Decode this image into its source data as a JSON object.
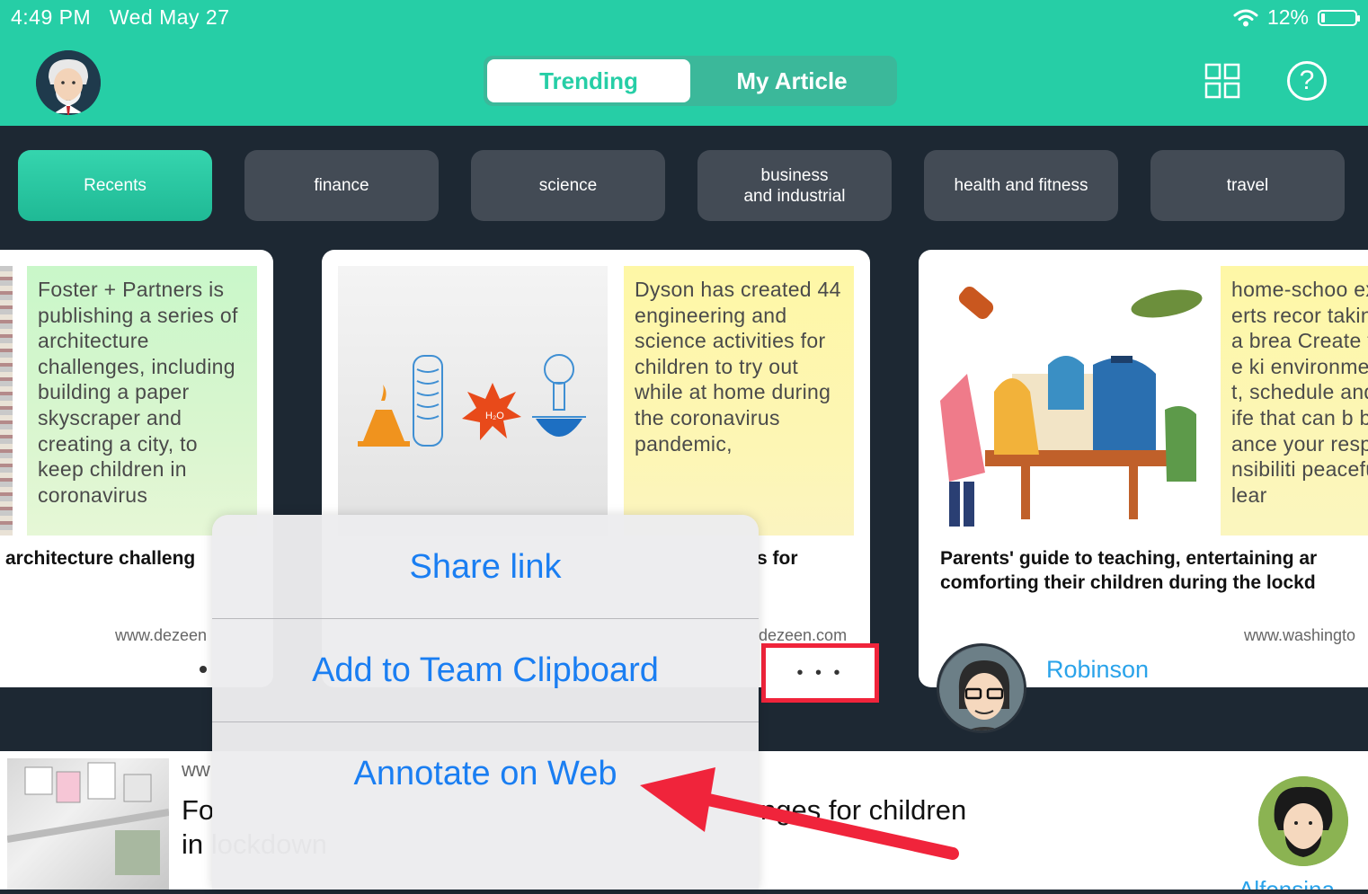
{
  "status_bar": {
    "time": "4:49 PM",
    "date": "Wed May 27",
    "battery": "12%"
  },
  "header": {
    "tabs": [
      {
        "label": "Trending",
        "selected": true
      },
      {
        "label": "My Article",
        "selected": false
      }
    ],
    "grid_icon": "grid-icon",
    "help_icon": "?"
  },
  "categories": [
    {
      "label": "Recents",
      "active": true
    },
    {
      "label": "finance"
    },
    {
      "label": "science"
    },
    {
      "label": "business\nand industrial"
    },
    {
      "label": "health and fitness"
    },
    {
      "label": "travel"
    }
  ],
  "cards": [
    {
      "note": "Foster + Partners is publishing a series of architecture challenges, including building a paper skyscraper and creating a city, to keep children in coronavirus",
      "title": "architecture challeng",
      "source": "www.dezeen"
    },
    {
      "note": "Dyson has created 44 engineering and science activities for children to try out while at home during the coronavirus pandemic,",
      "title": "s for",
      "source": "dezeen.com",
      "more": "• • •"
    },
    {
      "note": "home-schoo experts recor taking a brea Create the ki environment, schedule and life that can b balance your responsibiliti peaceful lear",
      "title_line1": "Parents' guide to teaching, entertaining ar",
      "title_line2": "comforting their children during the lockd",
      "source": "www.washingto",
      "author": "Robinson"
    }
  ],
  "bottom_item": {
    "source": "ww",
    "title_part1": "Fo",
    "title_part2": "nges for children",
    "title_line2": "in lockdown",
    "author": "Alfonsina"
  },
  "action_sheet": {
    "items": [
      "Share link",
      "Add to Team Clipboard",
      "Annotate on Web"
    ]
  },
  "colors": {
    "accent": "#26cea6",
    "dark_bg": "#1d2833",
    "pill": "#434b55",
    "link_blue": "#1a7ef2",
    "highlight_red": "#f0243b"
  }
}
